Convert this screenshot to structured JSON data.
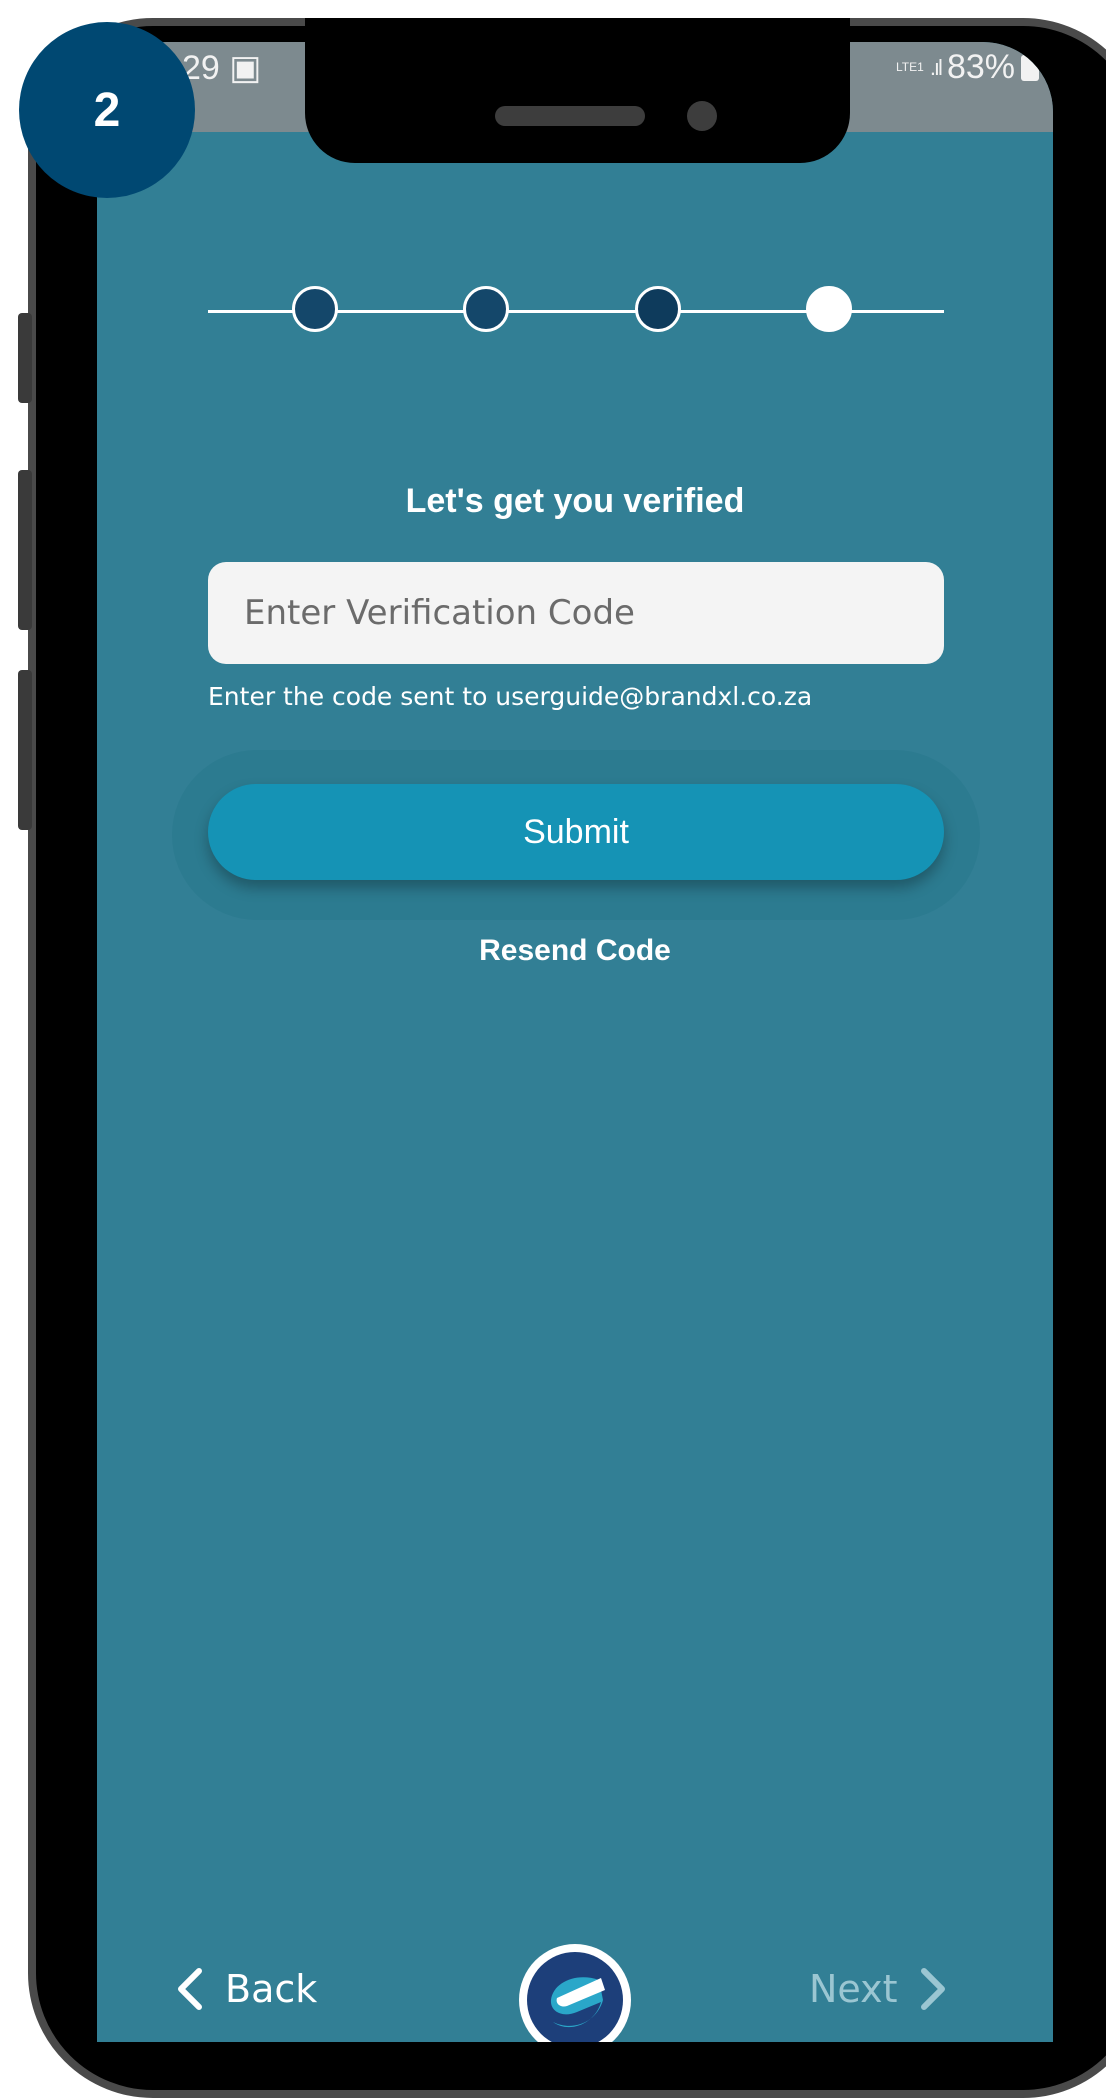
{
  "step_badge": "2",
  "status_bar": {
    "time_fragment": "29",
    "battery": "83%",
    "network": "LTE1"
  },
  "stepper": {
    "steps": 4,
    "current_step": 4,
    "dot_colors": [
      "#14476A",
      "#14476A",
      "#0E3B5C",
      "#FFFFFF"
    ]
  },
  "verify": {
    "title": "Let's get you verified",
    "code_placeholder": "Enter Verification Code",
    "code_value": "",
    "hint": "Enter the code sent to userguide@brandxl.co.za",
    "submit_label": "Submit",
    "resend_label": "Resend Code"
  },
  "footer": {
    "back_label": "Back",
    "next_label": "Next",
    "logo_icon": "app-logo-icon"
  },
  "colors": {
    "screen_bg": "#327F95",
    "submit_bg": "#1593B5",
    "badge_bg": "#004872"
  }
}
